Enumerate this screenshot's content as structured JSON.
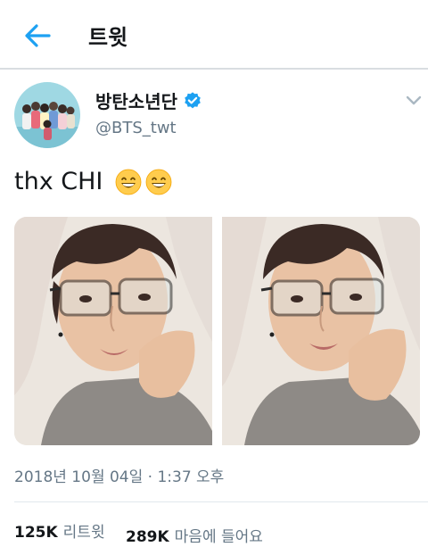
{
  "header": {
    "title": "트윗"
  },
  "author": {
    "display_name": "방탄소년단",
    "handle": "@BTS_twt"
  },
  "tweet": {
    "text": "thx CHI"
  },
  "meta": {
    "timestamp": "2018년 10월 04일 · 1:37 오후"
  },
  "stats": {
    "retweets": {
      "count": "125K",
      "label": "리트윗"
    },
    "likes": {
      "count": "289K",
      "label": "마음에 들어요"
    }
  },
  "icons": {
    "back": "back-arrow-icon",
    "verified": "verified-badge-icon",
    "caret": "chevron-down-icon",
    "emoji": "grinning-face-emoji"
  },
  "colors": {
    "accent": "#1da1f2",
    "muted": "#657786",
    "text": "#14171a"
  }
}
